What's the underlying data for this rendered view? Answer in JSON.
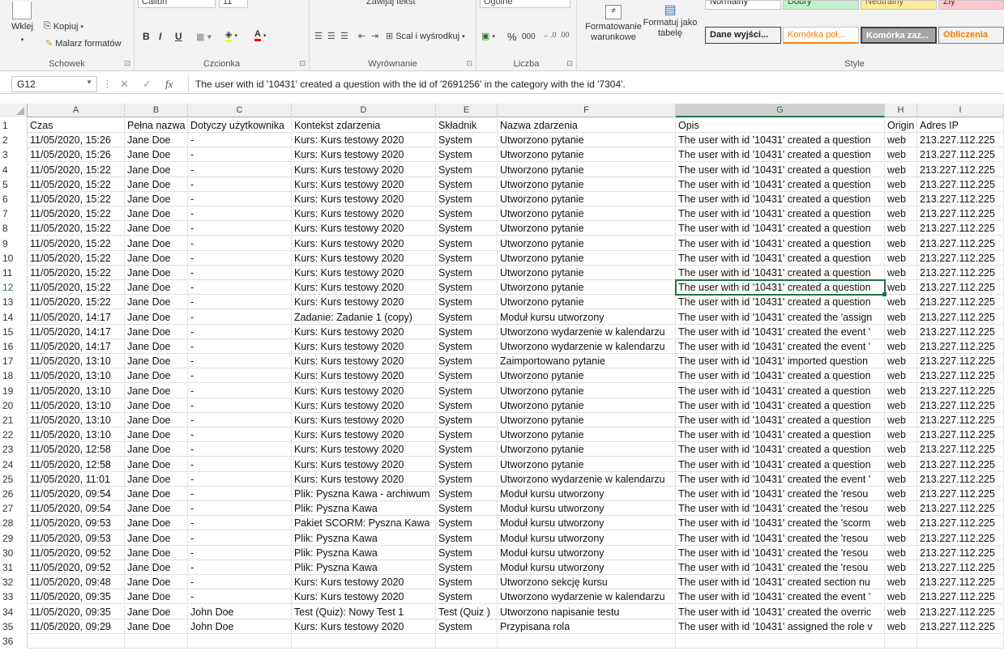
{
  "ribbon": {
    "clipboard": {
      "paste_label": "Wklej",
      "copy_label": "Kopiuj",
      "painter_label": "Malarz formatów",
      "group_label": "Schowek"
    },
    "font": {
      "name": "Calibri",
      "size": "11",
      "bold": "B",
      "italic": "I",
      "underline": "U",
      "group_label": "Czcionka"
    },
    "alignment": {
      "wrap_label": "Zawijaj tekst",
      "merge_label": "Scal i wyśrodkuj",
      "group_label": "Wyrównanie"
    },
    "number": {
      "format": "Ogólne",
      "percent": "%",
      "thousands": "000",
      "group_label": "Liczba"
    },
    "styles": {
      "conditional_label": "Formatowanie warunkowe",
      "table_label": "Formatuj jako tabelę",
      "top_row": [
        "Normalny",
        "Dobry",
        "Neutralny",
        "Zły"
      ],
      "bottom_row": [
        "Dane wyjści...",
        "Komórka poł...",
        "Komórka zaz...",
        "Obliczenia"
      ],
      "group_label": "Style"
    }
  },
  "formula_bar": {
    "cell_ref": "G12",
    "fx": "fx",
    "content": "The user with id '10431' created a question with the id of '2691256' in the category with the id '7304'."
  },
  "columns": [
    "A",
    "B",
    "C",
    "D",
    "E",
    "F",
    "G",
    "H",
    "I"
  ],
  "selected_cell": {
    "row": 12,
    "col": "G"
  },
  "header_row": [
    "Czas",
    "Pełna nazwa",
    "Dotyczy użytkownika",
    "Kontekst zdarzenia",
    "Składnik",
    "Nazwa zdarzenia",
    "Opis",
    "Origin",
    "Adres IP"
  ],
  "rows": [
    [
      "11/05/2020, 15:26",
      "Jane Doe",
      "-",
      "Kurs: Kurs testowy 2020",
      "System",
      "Utworzono pytanie",
      "The user with id '10431' created a question",
      "web",
      "213.227.112.225"
    ],
    [
      "11/05/2020, 15:26",
      "Jane Doe",
      "-",
      "Kurs: Kurs testowy 2020",
      "System",
      "Utworzono pytanie",
      "The user with id '10431' created a question",
      "web",
      "213.227.112.225"
    ],
    [
      "11/05/2020, 15:22",
      "Jane Doe",
      "-",
      "Kurs: Kurs testowy 2020",
      "System",
      "Utworzono pytanie",
      "The user with id '10431' created a question",
      "web",
      "213.227.112.225"
    ],
    [
      "11/05/2020, 15:22",
      "Jane Doe",
      "-",
      "Kurs: Kurs testowy 2020",
      "System",
      "Utworzono pytanie",
      "The user with id '10431' created a question",
      "web",
      "213.227.112.225"
    ],
    [
      "11/05/2020, 15:22",
      "Jane Doe",
      "-",
      "Kurs: Kurs testowy 2020",
      "System",
      "Utworzono pytanie",
      "The user with id '10431' created a question",
      "web",
      "213.227.112.225"
    ],
    [
      "11/05/2020, 15:22",
      "Jane Doe",
      "-",
      "Kurs: Kurs testowy 2020",
      "System",
      "Utworzono pytanie",
      "The user with id '10431' created a question",
      "web",
      "213.227.112.225"
    ],
    [
      "11/05/2020, 15:22",
      "Jane Doe",
      "-",
      "Kurs: Kurs testowy 2020",
      "System",
      "Utworzono pytanie",
      "The user with id '10431' created a question",
      "web",
      "213.227.112.225"
    ],
    [
      "11/05/2020, 15:22",
      "Jane Doe",
      "-",
      "Kurs: Kurs testowy 2020",
      "System",
      "Utworzono pytanie",
      "The user with id '10431' created a question",
      "web",
      "213.227.112.225"
    ],
    [
      "11/05/2020, 15:22",
      "Jane Doe",
      "-",
      "Kurs: Kurs testowy 2020",
      "System",
      "Utworzono pytanie",
      "The user with id '10431' created a question",
      "web",
      "213.227.112.225"
    ],
    [
      "11/05/2020, 15:22",
      "Jane Doe",
      "-",
      "Kurs: Kurs testowy 2020",
      "System",
      "Utworzono pytanie",
      "The user with id '10431' created a question",
      "web",
      "213.227.112.225"
    ],
    [
      "11/05/2020, 15:22",
      "Jane Doe",
      "-",
      "Kurs: Kurs testowy 2020",
      "System",
      "Utworzono pytanie",
      "The user with id '10431' created a question",
      "web",
      "213.227.112.225"
    ],
    [
      "11/05/2020, 15:22",
      "Jane Doe",
      "-",
      "Kurs: Kurs testowy 2020",
      "System",
      "Utworzono pytanie",
      "The user with id '10431' created a question",
      "web",
      "213.227.112.225"
    ],
    [
      "11/05/2020, 14:17",
      "Jane Doe",
      "-",
      "Zadanie: Zadanie 1 (copy)",
      "System",
      "Moduł kursu utworzony",
      "The user with id '10431' created the 'assign",
      "web",
      "213.227.112.225"
    ],
    [
      "11/05/2020, 14:17",
      "Jane Doe",
      "-",
      "Kurs: Kurs testowy 2020",
      "System",
      "Utworzono wydarzenie w kalendarzu",
      "The user with id '10431' created the event '",
      "web",
      "213.227.112.225"
    ],
    [
      "11/05/2020, 14:17",
      "Jane Doe",
      "-",
      "Kurs: Kurs testowy 2020",
      "System",
      "Utworzono wydarzenie w kalendarzu",
      "The user with id '10431' created the event '",
      "web",
      "213.227.112.225"
    ],
    [
      "11/05/2020, 13:10",
      "Jane Doe",
      "-",
      "Kurs: Kurs testowy 2020",
      "System",
      "Zaimportowano pytanie",
      "The user with id '10431' imported question",
      "web",
      "213.227.112.225"
    ],
    [
      "11/05/2020, 13:10",
      "Jane Doe",
      "-",
      "Kurs: Kurs testowy 2020",
      "System",
      "Utworzono pytanie",
      "The user with id '10431' created a question",
      "web",
      "213.227.112.225"
    ],
    [
      "11/05/2020, 13:10",
      "Jane Doe",
      "-",
      "Kurs: Kurs testowy 2020",
      "System",
      "Utworzono pytanie",
      "The user with id '10431' created a question",
      "web",
      "213.227.112.225"
    ],
    [
      "11/05/2020, 13:10",
      "Jane Doe",
      "-",
      "Kurs: Kurs testowy 2020",
      "System",
      "Utworzono pytanie",
      "The user with id '10431' created a question",
      "web",
      "213.227.112.225"
    ],
    [
      "11/05/2020, 13:10",
      "Jane Doe",
      "-",
      "Kurs: Kurs testowy 2020",
      "System",
      "Utworzono pytanie",
      "The user with id '10431' created a question",
      "web",
      "213.227.112.225"
    ],
    [
      "11/05/2020, 13:10",
      "Jane Doe",
      "-",
      "Kurs: Kurs testowy 2020",
      "System",
      "Utworzono pytanie",
      "The user with id '10431' created a question",
      "web",
      "213.227.112.225"
    ],
    [
      "11/05/2020, 12:58",
      "Jane Doe",
      "-",
      "Kurs: Kurs testowy 2020",
      "System",
      "Utworzono pytanie",
      "The user with id '10431' created a question",
      "web",
      "213.227.112.225"
    ],
    [
      "11/05/2020, 12:58",
      "Jane Doe",
      "-",
      "Kurs: Kurs testowy 2020",
      "System",
      "Utworzono pytanie",
      "The user with id '10431' created a question",
      "web",
      "213.227.112.225"
    ],
    [
      "11/05/2020, 11:01",
      "Jane Doe",
      "-",
      "Kurs: Kurs testowy 2020",
      "System",
      "Utworzono wydarzenie w kalendarzu",
      "The user with id '10431' created the event '",
      "web",
      "213.227.112.225"
    ],
    [
      "11/05/2020, 09:54",
      "Jane Doe",
      "-",
      "Plik: Pyszna Kawa - archiwum",
      "System",
      "Moduł kursu utworzony",
      "The user with id '10431' created the 'resou",
      "web",
      "213.227.112.225"
    ],
    [
      "11/05/2020, 09:54",
      "Jane Doe",
      "-",
      "Plik: Pyszna Kawa",
      "System",
      "Moduł kursu utworzony",
      "The user with id '10431' created the 'resou",
      "web",
      "213.227.112.225"
    ],
    [
      "11/05/2020, 09:53",
      "Jane Doe",
      "-",
      "Pakiet SCORM: Pyszna Kawa",
      "System",
      "Moduł kursu utworzony",
      "The user with id '10431' created the 'scorm",
      "web",
      "213.227.112.225"
    ],
    [
      "11/05/2020, 09:53",
      "Jane Doe",
      "-",
      "Plik: Pyszna Kawa",
      "System",
      "Moduł kursu utworzony",
      "The user with id '10431' created the 'resou",
      "web",
      "213.227.112.225"
    ],
    [
      "11/05/2020, 09:52",
      "Jane Doe",
      "-",
      "Plik: Pyszna Kawa",
      "System",
      "Moduł kursu utworzony",
      "The user with id '10431' created the 'resou",
      "web",
      "213.227.112.225"
    ],
    [
      "11/05/2020, 09:52",
      "Jane Doe",
      "-",
      "Plik: Pyszna Kawa",
      "System",
      "Moduł kursu utworzony",
      "The user with id '10431' created the 'resou",
      "web",
      "213.227.112.225"
    ],
    [
      "11/05/2020, 09:48",
      "Jane Doe",
      "-",
      "Kurs: Kurs testowy 2020",
      "System",
      "Utworzono sekcję kursu",
      "The user with id '10431' created section nu",
      "web",
      "213.227.112.225"
    ],
    [
      "11/05/2020, 09:35",
      "Jane Doe",
      "-",
      "Kurs: Kurs testowy 2020",
      "System",
      "Utworzono wydarzenie w kalendarzu",
      "The user with id '10431' created the event '",
      "web",
      "213.227.112.225"
    ],
    [
      "11/05/2020, 09:35",
      "Jane Doe",
      "John Doe",
      "Test (Quiz): Nowy Test 1",
      "Test (Quiz )",
      "Utworzono napisanie testu",
      "The user with id '10431' created the overric",
      "web",
      "213.227.112.225"
    ],
    [
      "11/05/2020, 09:29",
      "Jane Doe",
      "John Doe",
      "Kurs: Kurs testowy 2020",
      "System",
      "Przypisana rola",
      "The user with id '10431' assigned the role v",
      "web",
      "213.227.112.225"
    ]
  ],
  "last_row_number": "36",
  "colors": {
    "accent": "#217346",
    "style_good": "#c6efce",
    "style_neutral": "#ffeb9c",
    "style_bad": "#ffc7ce",
    "style_output": "#f2f2f2",
    "style_linked": "#ffffff",
    "style_check": "#a5a5a5",
    "style_calc": "#f2f2f2"
  }
}
